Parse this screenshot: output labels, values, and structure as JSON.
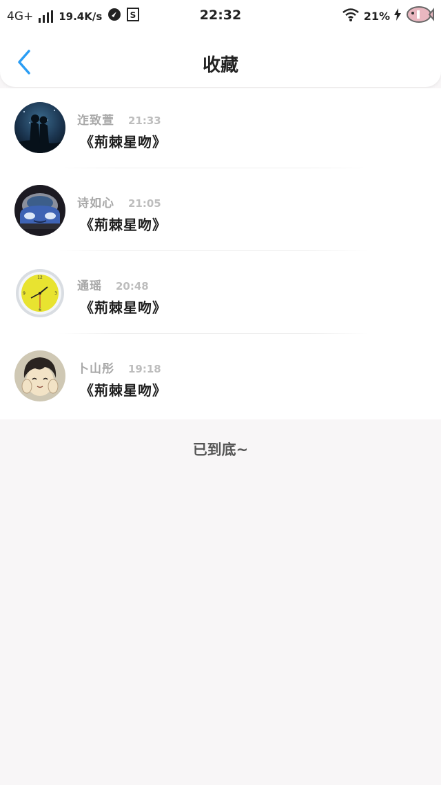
{
  "status_bar": {
    "network": "4G+",
    "speed": "19.4K/s",
    "time": "22:32",
    "battery": "21%"
  },
  "header": {
    "title": "收藏",
    "accent_color": "#2a9df4"
  },
  "items": [
    {
      "user": "迮致萱",
      "time": "21:33",
      "title": "《荊棘星吻》",
      "avatar": "couple-silhouette-avatar"
    },
    {
      "user": "诗如心",
      "time": "21:05",
      "title": "《荊棘星吻》",
      "avatar": "blue-car-avatar"
    },
    {
      "user": "通瑶",
      "time": "20:48",
      "title": "《荊棘星吻》",
      "avatar": "yellow-clock-avatar"
    },
    {
      "user": "卜山彤",
      "time": "19:18",
      "title": "《荊棘星吻》",
      "avatar": "anime-boy-avatar"
    }
  ],
  "footer": {
    "end_text": "已到底~"
  }
}
